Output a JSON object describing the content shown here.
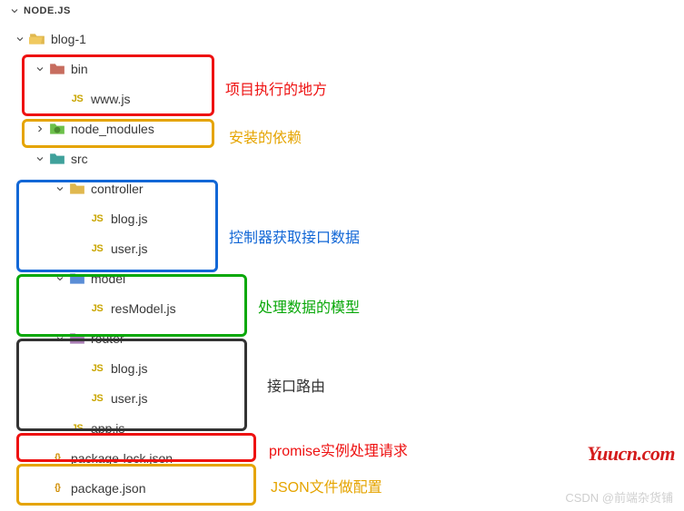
{
  "panel": {
    "title": "NODE.JS"
  },
  "tree": {
    "root": {
      "name": "blog-1"
    },
    "bin": {
      "name": "bin",
      "files": {
        "www": "www.js"
      }
    },
    "node_modules": {
      "name": "node_modules"
    },
    "src": {
      "name": "src"
    },
    "controller": {
      "name": "controller",
      "files": {
        "blog": "blog.js",
        "user": "user.js"
      }
    },
    "model": {
      "name": "model",
      "files": {
        "resModel": "resModel.js"
      }
    },
    "router": {
      "name": "router",
      "files": {
        "blog": "blog.js",
        "user": "user.js"
      }
    },
    "app": {
      "name": "app.js"
    },
    "packageLock": {
      "name": "package-lock.json"
    },
    "package": {
      "name": "package.json"
    }
  },
  "annotations": {
    "bin": {
      "text": "项目执行的地方",
      "color": "#e11"
    },
    "node_modules": {
      "text": "安装的依赖",
      "color": "#e5a400"
    },
    "controller": {
      "text": "控制器获取接口数据",
      "color": "#1267d6"
    },
    "model": {
      "text": "处理数据的模型",
      "color": "#0aa80a"
    },
    "router": {
      "text": "接口路由",
      "color": "#333"
    },
    "app": {
      "text": "promise实例处理请求",
      "color": "#e11"
    },
    "package": {
      "text": "JSON文件做配置",
      "color": "#e5a400"
    }
  },
  "watermarks": {
    "csdn": "CSDN @前端杂货铺",
    "yuucn": "Yuucn.com"
  }
}
